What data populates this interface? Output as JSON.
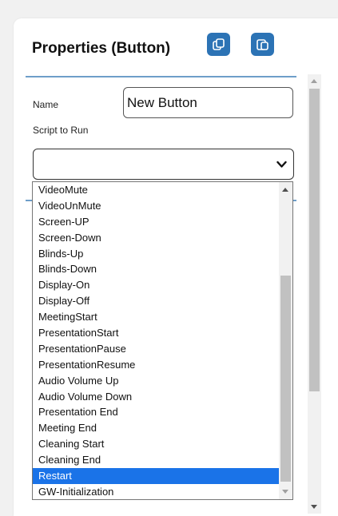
{
  "panel": {
    "title": "Properties (Button)",
    "accent_color": "#2c73b5",
    "copy_icon": "copy-icon",
    "paste_icon": "paste-icon"
  },
  "form": {
    "name_label": "Name",
    "name_value": "New Button",
    "script_label": "Script to Run",
    "script_selected": "",
    "select_icon": "chevron-down-icon"
  },
  "dropdown": {
    "options": [
      "VideoMute",
      "VideoUnMute",
      "Screen-UP",
      "Screen-Down",
      "Blinds-Up",
      "Blinds-Down",
      "Display-On",
      "Display-Off",
      "MeetingStart",
      "PresentationStart",
      "PresentationPause",
      "PresentationResume",
      "Audio Volume Up",
      "Audio Volume Down",
      "Presentation End",
      "Meeting End",
      "Cleaning Start",
      "Cleaning End",
      "Restart",
      "GW-Initialization"
    ],
    "highlighted": "Restart",
    "highlight_color": "#1a73e8"
  }
}
